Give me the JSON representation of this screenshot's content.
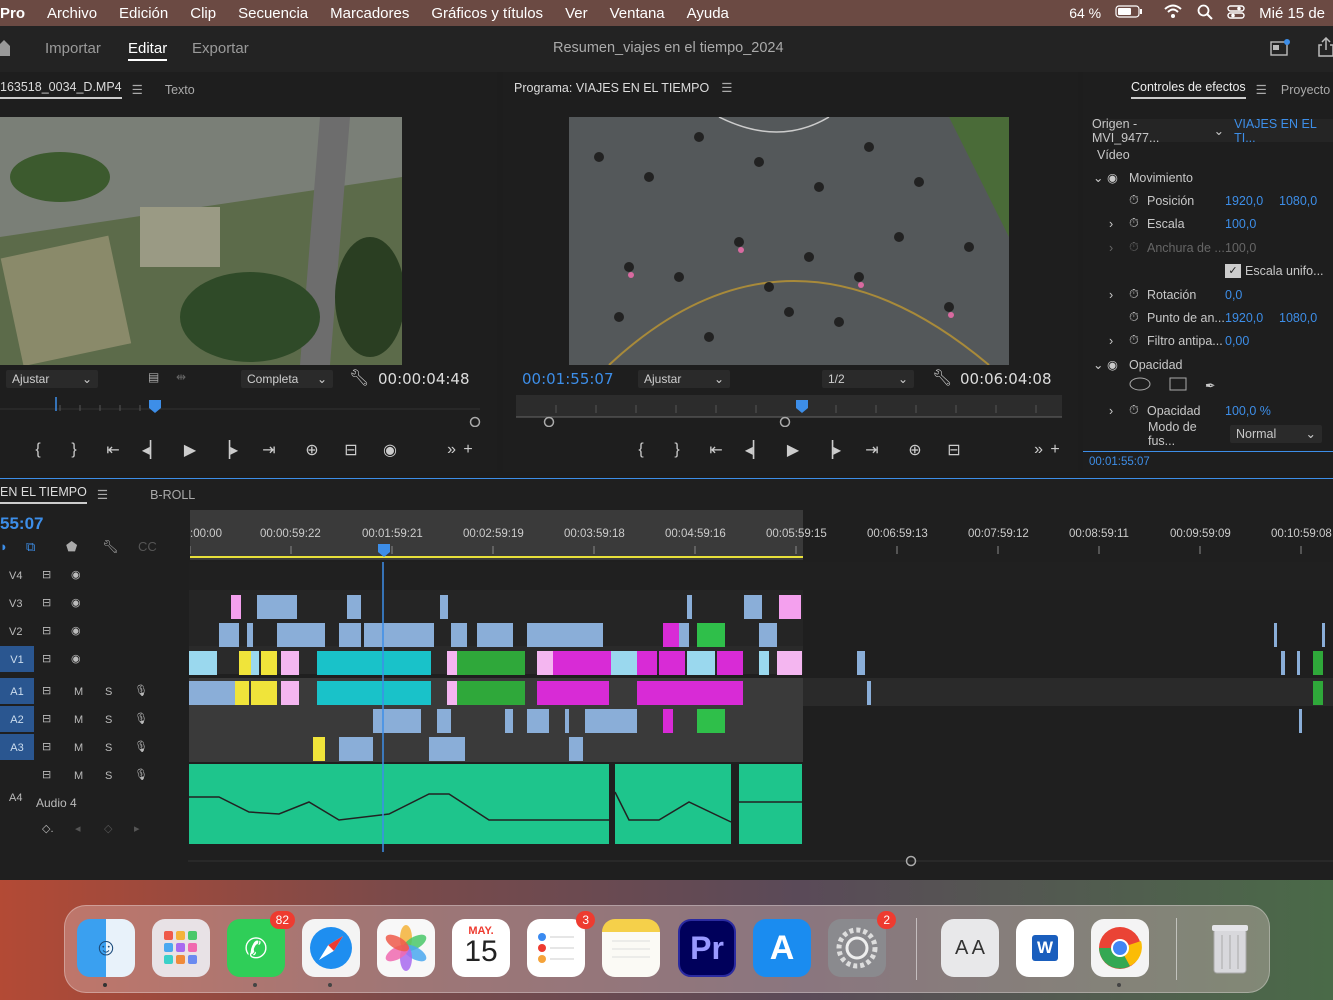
{
  "menubar": {
    "app": "Pro",
    "items": [
      "Archivo",
      "Edición",
      "Clip",
      "Secuencia",
      "Marcadores",
      "Gráficos y títulos",
      "Ver",
      "Ventana",
      "Ayuda"
    ],
    "battery": "64 %",
    "date": "Mié 15 de"
  },
  "appbar": {
    "tabs": [
      "Importar",
      "Editar",
      "Exportar"
    ],
    "title": "Resumen_viajes en el tiempo_2024"
  },
  "source": {
    "tab_clip": "163518_0034_D.MP4",
    "tab_text": "Texto",
    "fit": "Ajustar",
    "quality": "Completa",
    "timecode": "00:00:04:48"
  },
  "program": {
    "title": "Programa: VIAJES EN EL TIEMPO",
    "current_tc": "00:01:55:07",
    "fit": "Ajustar",
    "quality": "1/2",
    "duration_tc": "00:06:04:08"
  },
  "effects": {
    "tab": "Controles de efectos",
    "tab2": "Proyecto",
    "origin": "Origen - MVI_9477...",
    "sequence": "VIAJES EN EL TI...",
    "video": "Vídeo",
    "movimiento": "Movimiento",
    "posicion": "Posición",
    "pos_x": "1920,0",
    "pos_y": "1080,0",
    "escala": "Escala",
    "escala_v": "100,0",
    "anchura": "Anchura de ...",
    "anchura_v": "100,0",
    "escala_unif": "Escala unifo...",
    "rotacion": "Rotación",
    "rotacion_v": "0,0",
    "punto": "Punto de an...",
    "punto_x": "1920,0",
    "punto_y": "1080,0",
    "filtro": "Filtro antipa...",
    "filtro_v": "0,00",
    "opacidad_hdr": "Opacidad",
    "opacidad": "Opacidad",
    "opacidad_v": "100,0 %",
    "modo": "Modo de fus...",
    "modo_v": "Normal",
    "timecode": "00:01:55:07"
  },
  "timeline": {
    "tab1": "EN EL TIEMPO",
    "tab2": "B-ROLL",
    "playhead_tc": "55:07",
    "ruler": [
      ":00:00",
      "00:00:59:22",
      "00:01:59:21",
      "00:02:59:19",
      "00:03:59:18",
      "00:04:59:16",
      "00:05:59:15",
      "00:06:59:13",
      "00:07:59:12",
      "00:08:59:11",
      "00:09:59:09",
      "00:10:59:08"
    ],
    "video_tracks": [
      "V4",
      "V3",
      "V2",
      "V1"
    ],
    "audio_tracks": [
      "A1",
      "A2",
      "A3",
      "A4"
    ],
    "audio4_name": "Audio 4",
    "m": "M",
    "s": "S"
  },
  "dock": {
    "whatsapp_badge": "82",
    "calendar_month": "MAY.",
    "calendar_day": "15",
    "reminders_badge": "3",
    "premiere": "Pr",
    "settings_badge": "2",
    "font_book": "A A",
    "word": "W"
  },
  "colors": {
    "accent_blue": "#3d8ee8",
    "clip_blue": "#8aaed8",
    "clip_cyan": "#19c2c9",
    "clip_green": "#2fa83a",
    "clip_magenta": "#d82bd6",
    "clip_pink": "#f4b6f0",
    "clip_yellow": "#f0e43a",
    "audio_green": "#1ec58c"
  }
}
